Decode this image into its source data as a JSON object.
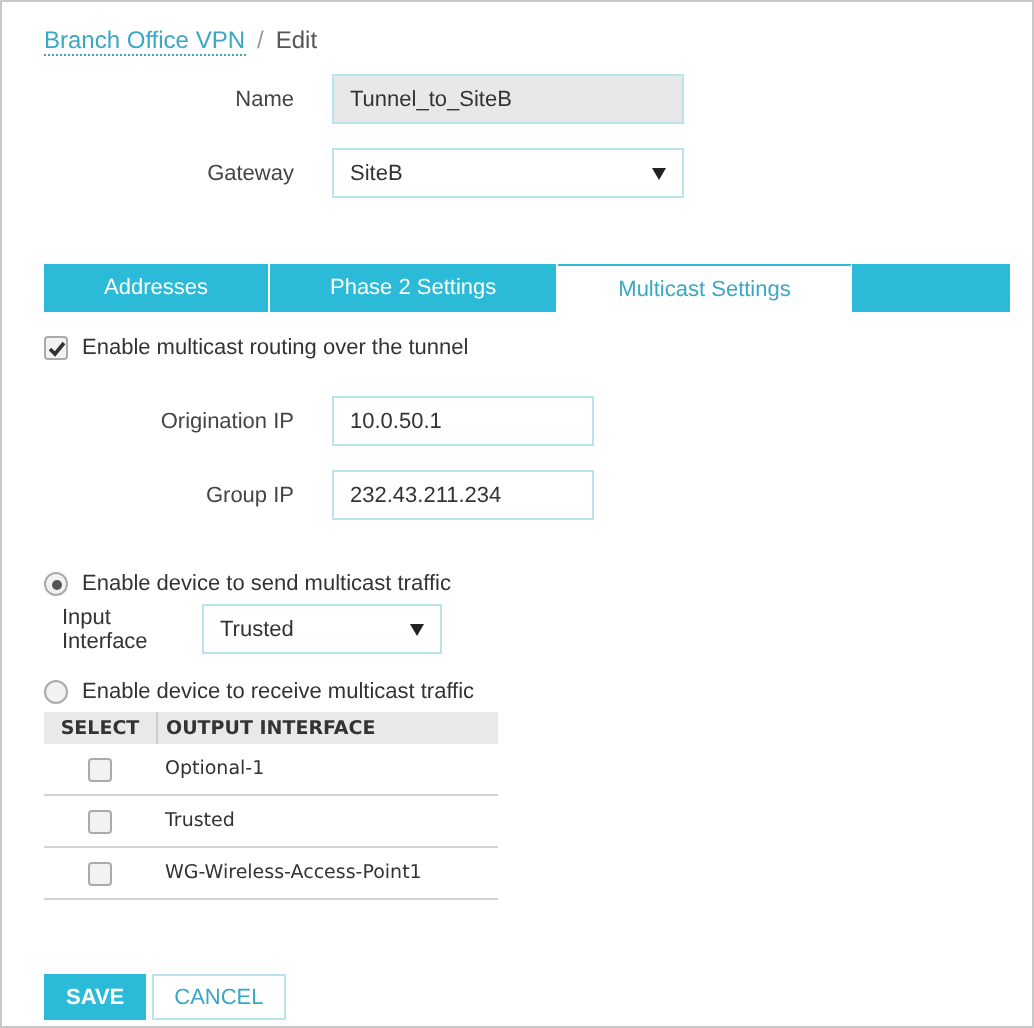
{
  "breadcrumb": {
    "link": "Branch Office VPN",
    "separator": "/",
    "current": "Edit"
  },
  "fields": [
    {
      "label": "Name",
      "value": "Tunnel_to_SiteB",
      "kind": "readonly"
    },
    {
      "label": "Gateway",
      "value": "SiteB",
      "kind": "select"
    }
  ],
  "tabs": [
    {
      "label": "Addresses",
      "selected": false
    },
    {
      "label": "Phase 2 Settings",
      "selected": false
    },
    {
      "label": "Multicast Settings",
      "selected": true
    }
  ],
  "enable_multicast": {
    "label": "Enable multicast routing over the tunnel",
    "checked": true
  },
  "ip_fields": [
    {
      "label": "Origination IP",
      "value": "10.0.50.1"
    },
    {
      "label": "Group IP",
      "value": "232.43.211.234"
    }
  ],
  "send_option": {
    "label": "Enable device to send multicast traffic",
    "selected": true
  },
  "input_interface": {
    "label": "Input Interface",
    "value": "Trusted"
  },
  "receive_option": {
    "label": "Enable device to receive multicast traffic",
    "selected": false
  },
  "table": {
    "columns": [
      "SELECT",
      "OUTPUT INTERFACE"
    ],
    "rows": [
      {
        "name": "Optional-1",
        "checked": false
      },
      {
        "name": "Trusted",
        "checked": false
      },
      {
        "name": "WG-Wireless-Access-Point1",
        "checked": false
      }
    ]
  },
  "buttons": [
    {
      "label": "SAVE",
      "kind": "primary"
    },
    {
      "label": "CANCEL",
      "kind": "secondary"
    }
  ]
}
